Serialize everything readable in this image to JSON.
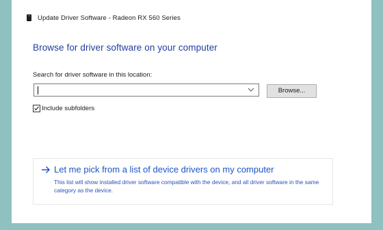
{
  "window": {
    "title": "Update Driver Software - Radeon RX 560 Series",
    "device_icon": "video-card-icon"
  },
  "main": {
    "heading": "Browse for driver software on your computer",
    "search_label": "Search for driver software in this location:",
    "path_value": "",
    "browse_label": "Browse...",
    "include_subfolders": {
      "label": "Include subfolders",
      "checked": true
    }
  },
  "pick_option": {
    "icon": "arrow-right-icon",
    "title": "Let me pick from a list of device drivers on my computer",
    "description": "This list will show installed driver software compatible with the device, and all driver software in the same category as the device."
  },
  "colors": {
    "accent": "#1f3f9f",
    "link": "#1a55c8",
    "background": "#8fc1c1"
  }
}
